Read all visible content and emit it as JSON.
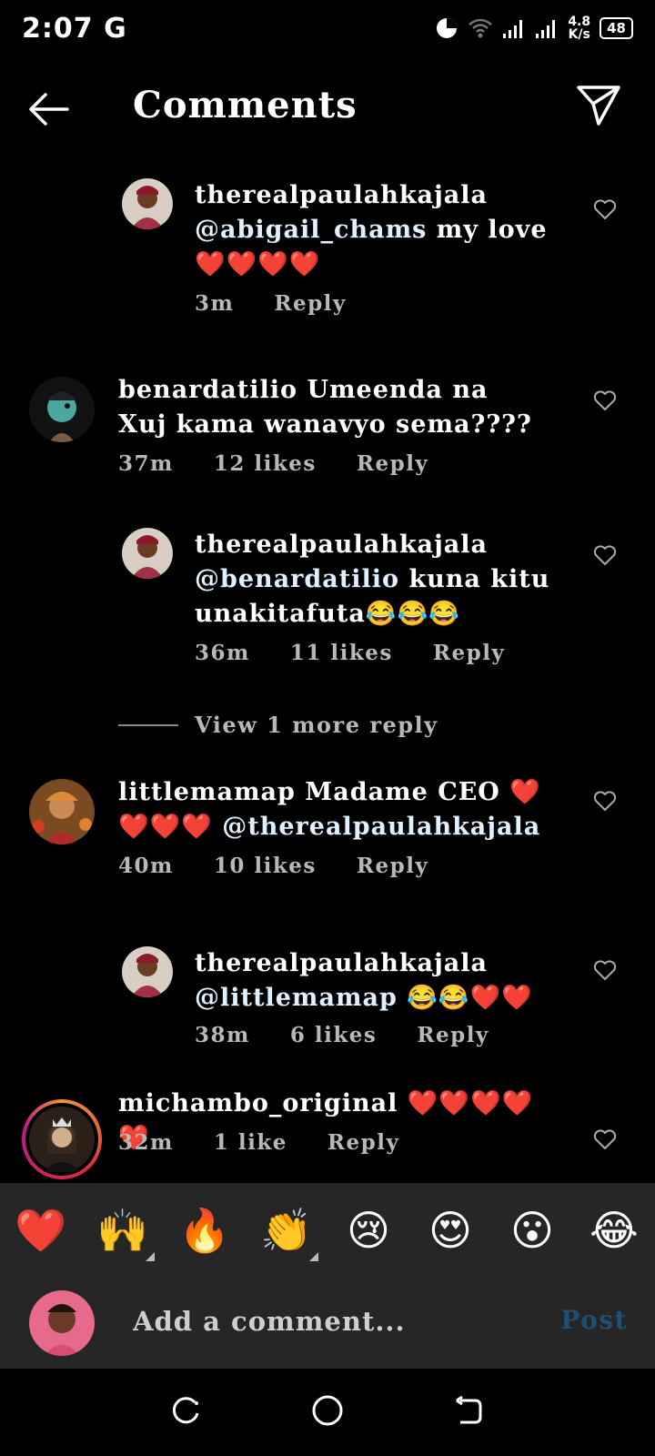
{
  "status": {
    "time": "2:07",
    "network_letter": "G",
    "speed_value": "4.8",
    "speed_unit": "K/s",
    "battery": "48"
  },
  "header": {
    "title": "Comments"
  },
  "comments": [
    {
      "username": "therealpaulahkajala",
      "mention": "@abigail_chams",
      "text": " my love❤️❤️❤️❤️",
      "time": "3m",
      "likes": "",
      "reply": "Reply"
    },
    {
      "username": "benardatilio",
      "mention": "",
      "text": " Umeenda na Xuj kama wanavyo sema????",
      "time": "37m",
      "likes": "12 likes",
      "reply": "Reply"
    },
    {
      "username": "therealpaulahkajala",
      "mention": "@benardatilio",
      "text": " kuna kitu unakitafuta😂😂😂",
      "time": "36m",
      "likes": "11 likes",
      "reply": "Reply"
    },
    {
      "username": "littlemamap",
      "mention": "",
      "text": " Madame CEO ❤️❤️❤️❤️ ",
      "mention2": "@therealpaulahkajala",
      "time": "40m",
      "likes": "10 likes",
      "reply": "Reply"
    },
    {
      "username": "therealpaulahkajala",
      "mention": "@littlemamap",
      "text": " 😂😂❤️❤️",
      "time": "38m",
      "likes": "6 likes",
      "reply": "Reply"
    },
    {
      "username": "michambo_original",
      "mention": "",
      "text": " ❤️❤️❤️❤️❤️",
      "time": "32m",
      "likes": "1 like",
      "reply": "Reply"
    }
  ],
  "view_more": "View 1 more reply",
  "emojis": [
    "❤️",
    "🙌",
    "🔥",
    "👏",
    "😢",
    "😍",
    "😮",
    "😂"
  ],
  "comment_bar": {
    "placeholder": "Add a comment...",
    "post_label": "Post"
  },
  "colors": {
    "background": "#000000",
    "bar": "#262626",
    "post_disabled": "#1f4f73",
    "meta": "#b8b8b8"
  }
}
